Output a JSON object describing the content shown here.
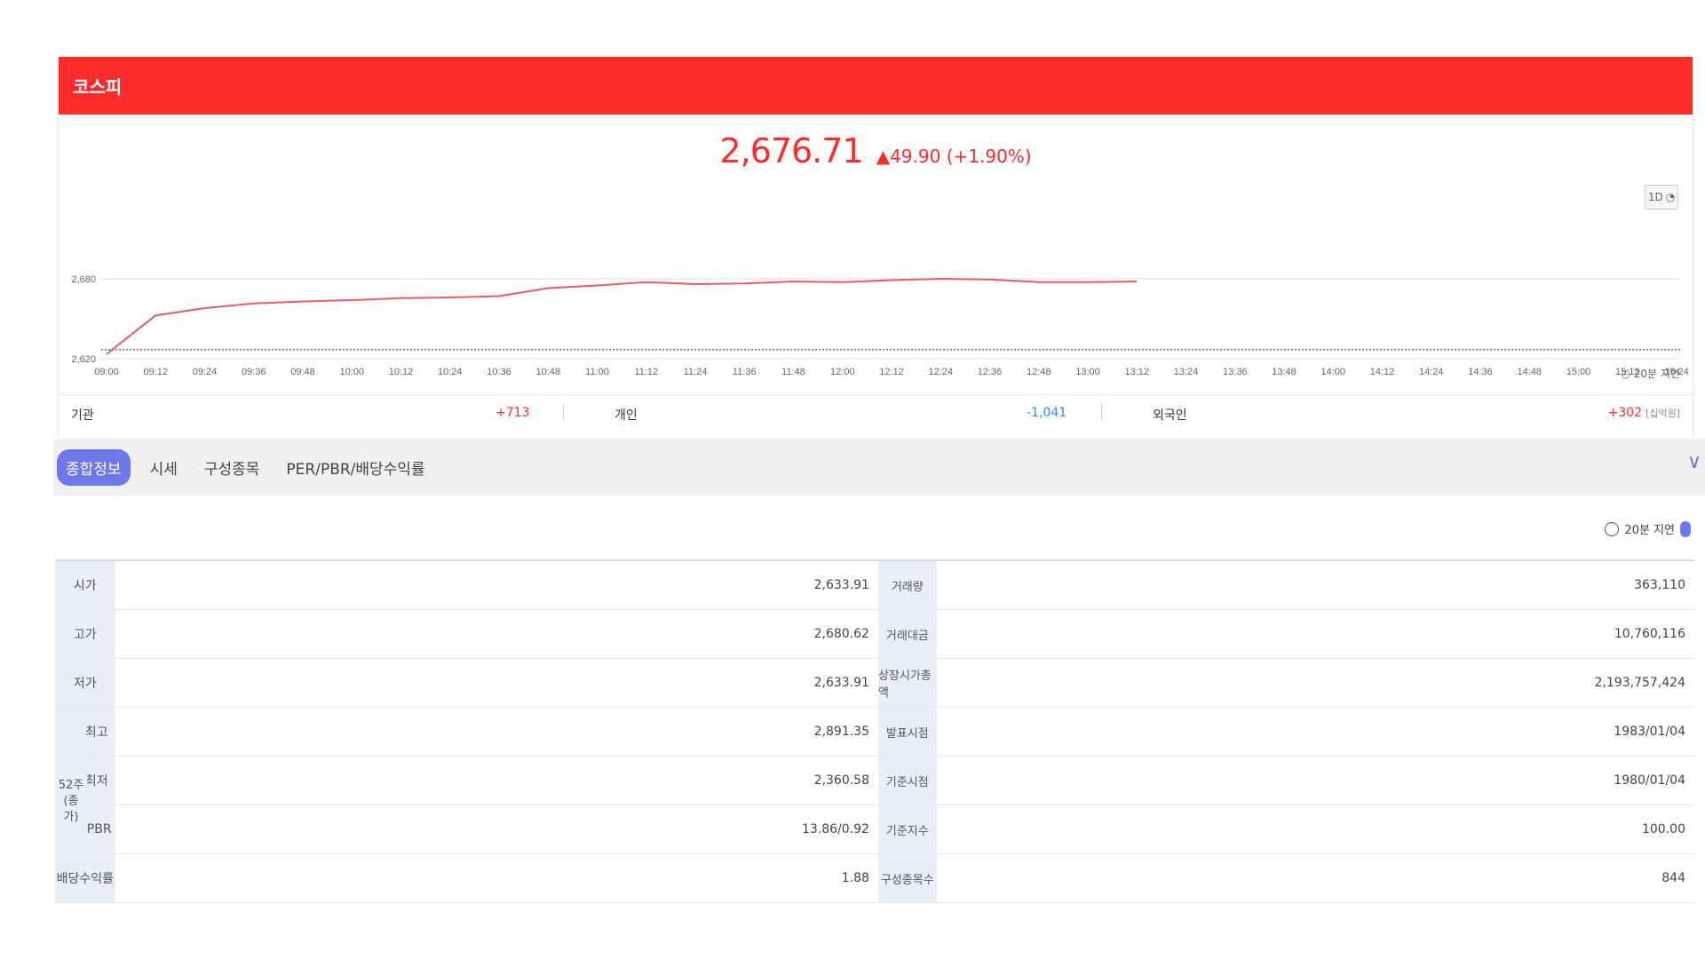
{
  "index": {
    "name": "코스피",
    "price": "2,676.71",
    "change": "▲49.90 (+1.90%)",
    "period_button": "1D",
    "delay_note": "20분 지연"
  },
  "chart_data": {
    "type": "line",
    "x": [
      "09:00",
      "09:12",
      "09:24",
      "09:36",
      "09:48",
      "10:00",
      "10:12",
      "10:24",
      "10:36",
      "10:48",
      "11:00",
      "11:12",
      "11:24",
      "11:36",
      "11:48",
      "12:00",
      "12:12",
      "12:24",
      "12:36",
      "12:48",
      "13:00",
      "13:12"
    ],
    "values": [
      2623.5,
      2652.5,
      2658.0,
      2661.5,
      2663.0,
      2664.0,
      2665.5,
      2666.0,
      2667.0,
      2673.0,
      2675.0,
      2677.5,
      2676.0,
      2676.5,
      2678.0,
      2677.5,
      2679.0,
      2680.0,
      2679.5,
      2677.5,
      2677.5,
      2678.0
    ],
    "x_axis_ticks": [
      "09:00",
      "09:12",
      "09:24",
      "09:36",
      "09:48",
      "10:00",
      "10:12",
      "10:24",
      "10:36",
      "10:48",
      "11:00",
      "11:12",
      "11:24",
      "11:36",
      "11:48",
      "12:00",
      "12:12",
      "12:24",
      "12:36",
      "12:48",
      "13:00",
      "13:12",
      "13:24",
      "13:36",
      "13:48",
      "14:00",
      "14:12",
      "14:24",
      "14:36",
      "14:48",
      "15:00",
      "15:12",
      "15:24"
    ],
    "y_ticks": [
      "2,680",
      "2,620"
    ],
    "ylim": [
      2620,
      2680
    ],
    "baseline": 2626.81,
    "color": "#e85a6a",
    "grid": true
  },
  "investors": [
    {
      "label": "기관",
      "value": "+713"
    },
    {
      "label": "개인",
      "value": "-1,041"
    },
    {
      "label": "외국인",
      "value": "+302",
      "unit": "[십억원]"
    }
  ],
  "tabs": [
    "종합정보",
    "시세",
    "구성종목",
    "PER/PBR/배당수익률"
  ],
  "active_tab": "종합정보",
  "table_delay": "20분 지연",
  "table": {
    "rows": [
      {
        "l1": "시가",
        "v1": "2,633.91",
        "l2": "거래량",
        "v2": "363,110"
      },
      {
        "l1": "고가",
        "v1": "2,680.62",
        "l2": "거래대금",
        "v2": "10,760,116"
      },
      {
        "l1": "저가",
        "v1": "2,633.91",
        "l2": "상장시가총액",
        "v2": "2,193,757,424"
      },
      {
        "l1": "최고",
        "v1": "2,891.35",
        "l2": "발표시점",
        "v2": "1983/01/04"
      },
      {
        "l1": "최저",
        "v1": "2,360.58",
        "l2": "기준시점",
        "v2": "1980/01/04"
      },
      {
        "l1": "PER/PBR",
        "v1": "13.86/0.92",
        "l2": "기준지수",
        "v2": "100.00"
      },
      {
        "l1": "배당수익률",
        "v1": "1.88",
        "l2": "구성종목수",
        "v2": "844"
      }
    ],
    "group_label_52w": "52주 (종가)"
  }
}
